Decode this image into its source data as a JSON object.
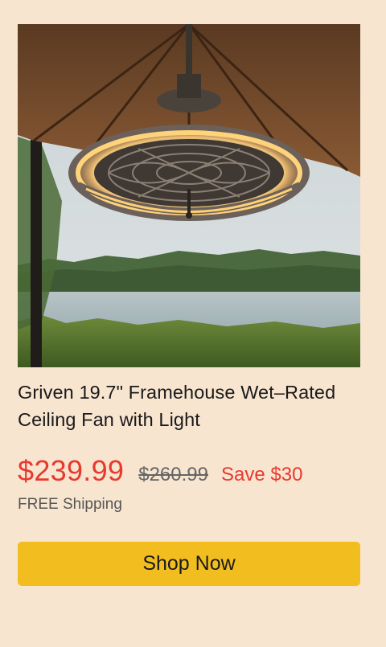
{
  "product": {
    "image_alt": "Outdoor caged ceiling fan with ring light under a patio umbrella by a lake",
    "title": "Griven 19.7\" Framehouse Wet–Rated Ceiling Fan with Light",
    "price": "$239.99",
    "was_price": "$260.99",
    "save_text": "Save $30",
    "shipping": "FREE Shipping"
  },
  "cta": {
    "label": "Shop Now"
  },
  "colors": {
    "background": "#f8e5d0",
    "price_red": "#e8392f",
    "button_yellow": "#f2be1f"
  }
}
